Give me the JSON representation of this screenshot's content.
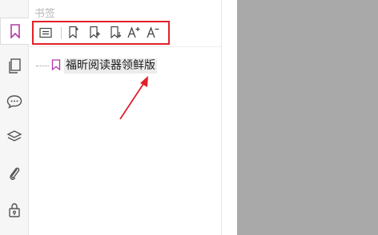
{
  "panel": {
    "title": "书签",
    "toolbar": {
      "items": [
        {
          "name": "bookmark-properties",
          "icon": "list-box-icon"
        },
        {
          "name": "add-bookmark",
          "icon": "bookmark-star-icon"
        },
        {
          "name": "add-child-bookmark",
          "icon": "bookmark-plus-icon"
        },
        {
          "name": "add-bookmark-down",
          "icon": "bookmark-arrow-icon"
        },
        {
          "name": "increase-font",
          "icon": "font-increase-icon"
        },
        {
          "name": "decrease-font",
          "icon": "font-decrease-icon"
        }
      ]
    },
    "bookmarks": [
      {
        "label": "福昕阅读器领鲜版"
      }
    ]
  },
  "sidebar": {
    "items": [
      {
        "name": "bookmarks",
        "icon": "bookmark-icon",
        "active": true
      },
      {
        "name": "pages",
        "icon": "pages-icon"
      },
      {
        "name": "comments",
        "icon": "comment-icon"
      },
      {
        "name": "layers",
        "icon": "layers-icon"
      },
      {
        "name": "attachments",
        "icon": "paperclip-icon"
      },
      {
        "name": "security",
        "icon": "lock-icon"
      }
    ]
  },
  "colors": {
    "accent": "#e2202a",
    "bookmark": "#b03aa6",
    "canvas": "#a9a9a9"
  }
}
